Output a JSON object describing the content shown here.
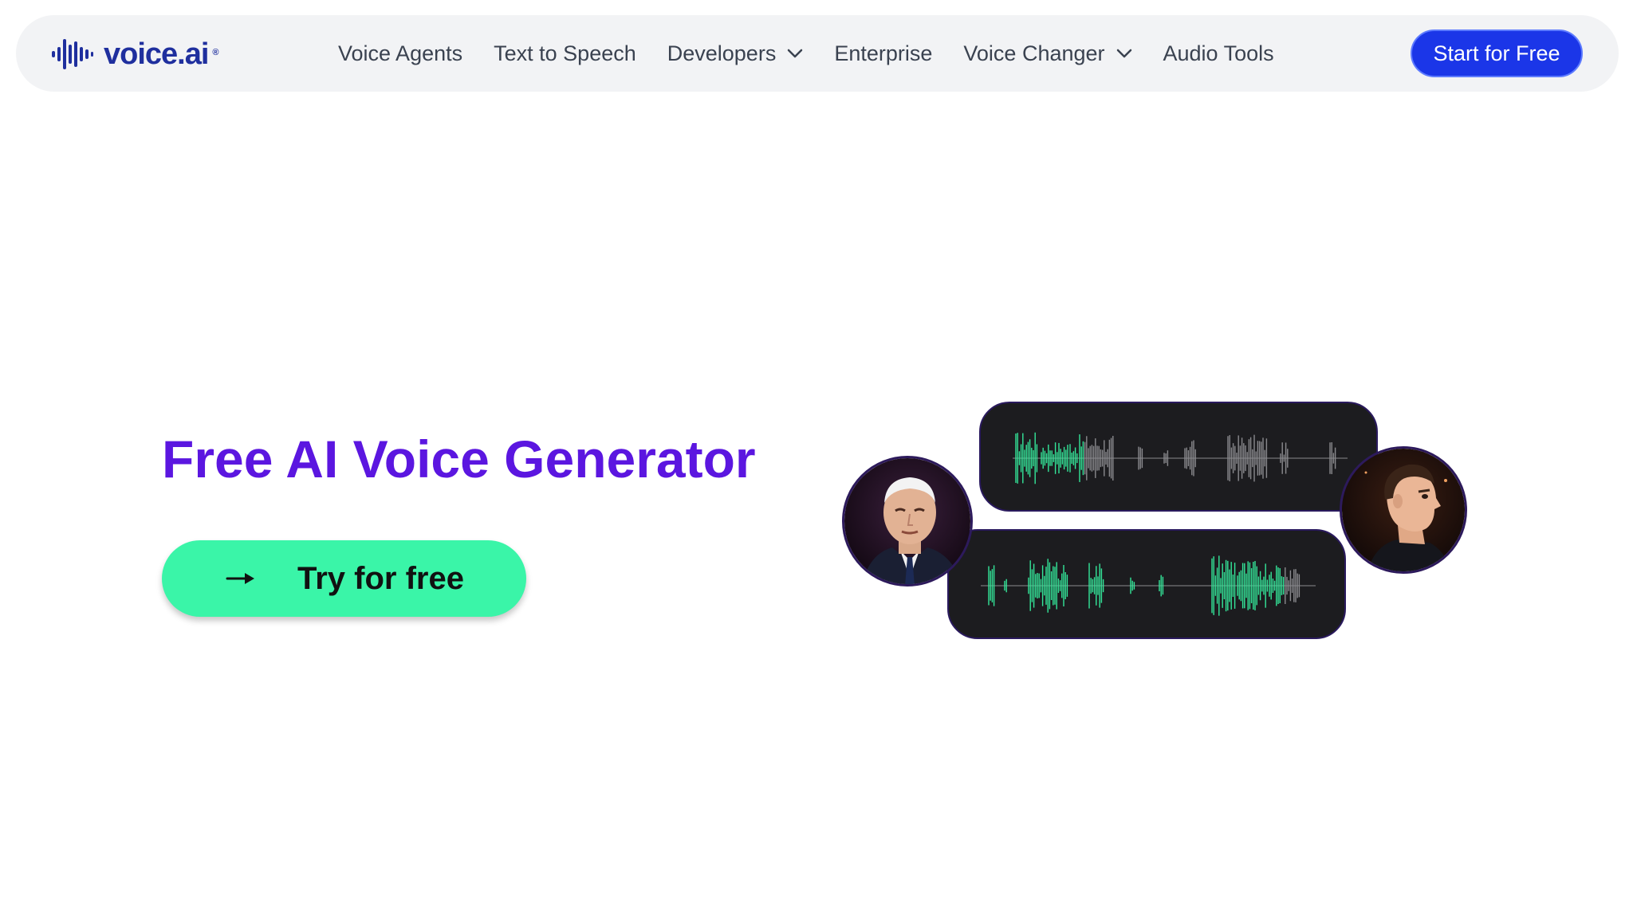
{
  "brand": {
    "name": "voice.ai",
    "registered_mark": "®",
    "logo_color": "#1f2f9e"
  },
  "nav": {
    "items": [
      {
        "label": "Voice Agents",
        "has_dropdown": false
      },
      {
        "label": "Text to Speech",
        "has_dropdown": false
      },
      {
        "label": "Developers",
        "has_dropdown": true
      },
      {
        "label": "Enterprise",
        "has_dropdown": false
      },
      {
        "label": "Voice Changer",
        "has_dropdown": true
      },
      {
        "label": "Audio Tools",
        "has_dropdown": false
      }
    ],
    "cta_label": "Start for Free",
    "cta_color": "#1b36e8"
  },
  "hero": {
    "title": "Free AI Voice Generator",
    "title_color": "#5b16e0",
    "button_label": "Try for free",
    "button_icon": "arrow-right-icon",
    "button_color": "#3af5a8"
  },
  "illustration": {
    "wave_active_color": "#34e79a",
    "wave_inactive_color": "#8a8a8e",
    "card_color": "#1c1c1f"
  }
}
